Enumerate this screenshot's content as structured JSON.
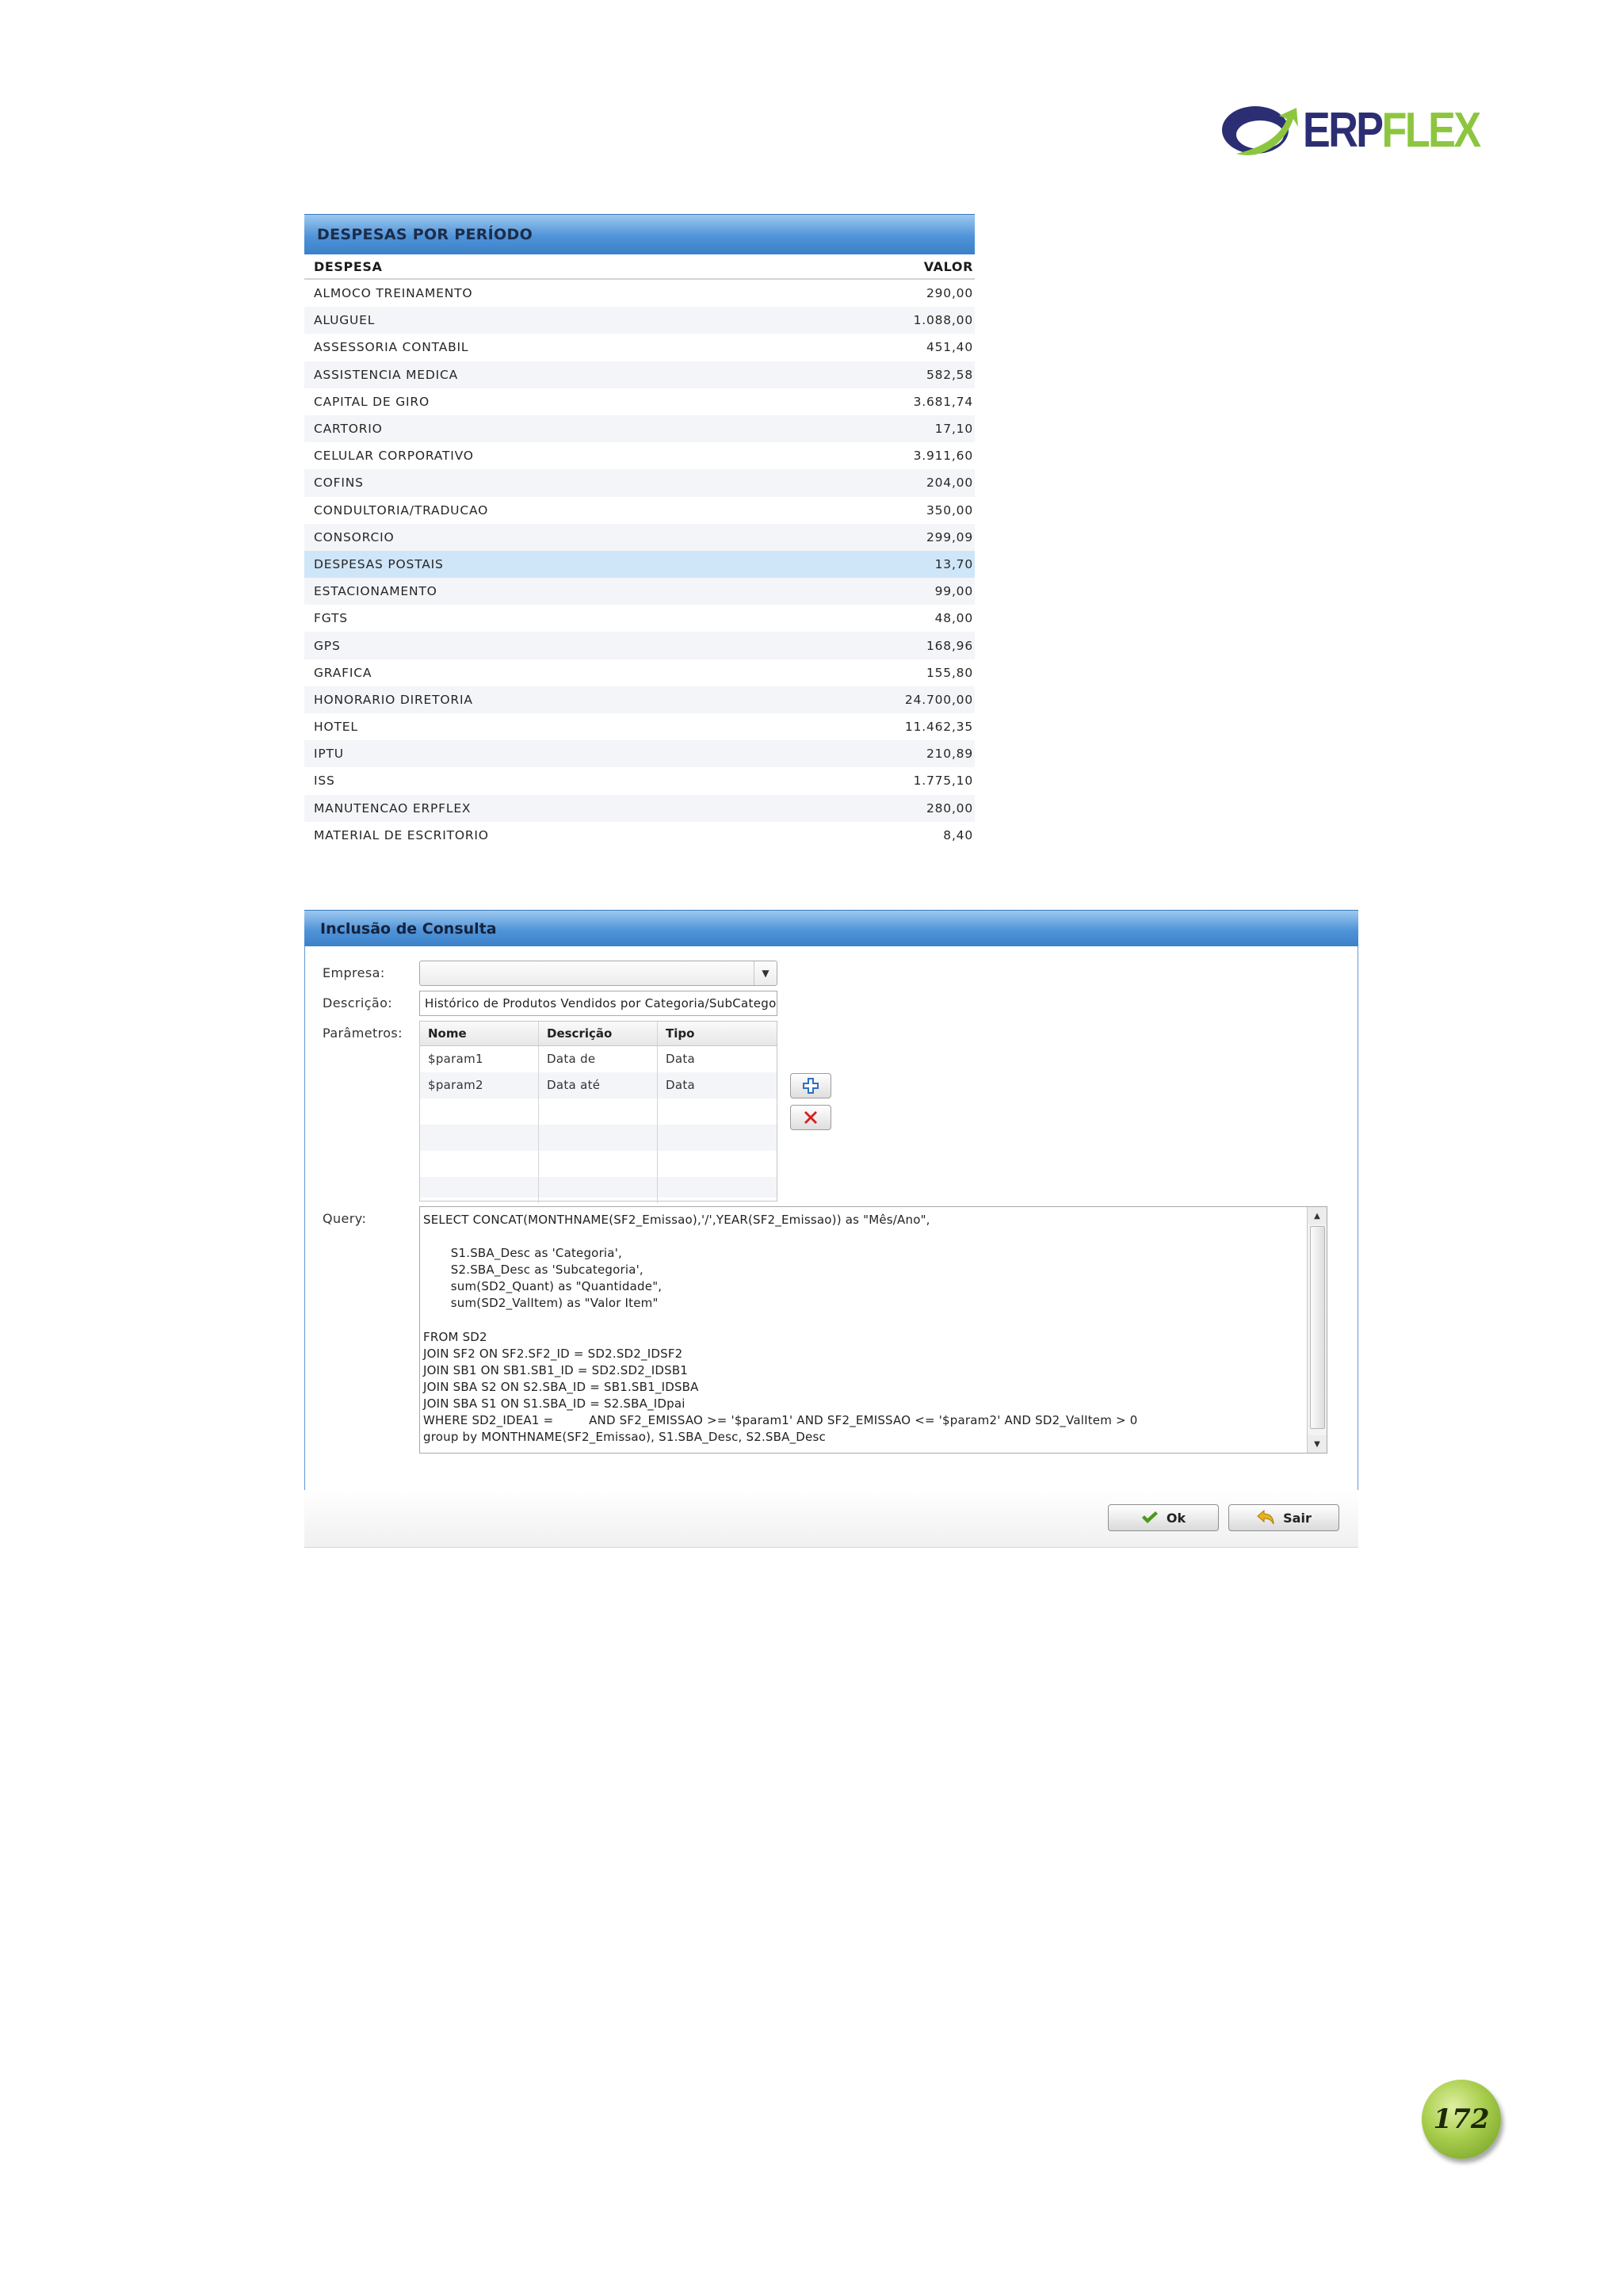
{
  "logo": {
    "part1": "ERP",
    "part2": "FLEX"
  },
  "expenses": {
    "title": "DESPESAS POR PERÍODO",
    "col_despesa": "DESPESA",
    "col_valor": "VALOR",
    "rows": [
      {
        "despesa": "ALMOCO TREINAMENTO",
        "valor": "290,00"
      },
      {
        "despesa": "ALUGUEL",
        "valor": "1.088,00"
      },
      {
        "despesa": "ASSESSORIA CONTABIL",
        "valor": "451,40"
      },
      {
        "despesa": "ASSISTENCIA MEDICA",
        "valor": "582,58"
      },
      {
        "despesa": "CAPITAL DE GIRO",
        "valor": "3.681,74"
      },
      {
        "despesa": "CARTORIO",
        "valor": "17,10"
      },
      {
        "despesa": "CELULAR CORPORATIVO",
        "valor": "3.911,60"
      },
      {
        "despesa": "COFINS",
        "valor": "204,00"
      },
      {
        "despesa": "CONDULTORIA/TRADUCAO",
        "valor": "350,00"
      },
      {
        "despesa": "CONSORCIO",
        "valor": "299,09"
      },
      {
        "despesa": "DESPESAS POSTAIS",
        "valor": "13,70"
      },
      {
        "despesa": "ESTACIONAMENTO",
        "valor": "99,00"
      },
      {
        "despesa": "FGTS",
        "valor": "48,00"
      },
      {
        "despesa": "GPS",
        "valor": "168,96"
      },
      {
        "despesa": "GRAFICA",
        "valor": "155,80"
      },
      {
        "despesa": "HONORARIO DIRETORIA",
        "valor": "24.700,00"
      },
      {
        "despesa": "HOTEL",
        "valor": "11.462,35"
      },
      {
        "despesa": "IPTU",
        "valor": "210,89"
      },
      {
        "despesa": "ISS",
        "valor": "1.775,10"
      },
      {
        "despesa": "MANUTENCAO ERPFLEX",
        "valor": "280,00"
      },
      {
        "despesa": "MATERIAL DE ESCRITORIO",
        "valor": "8,40"
      }
    ]
  },
  "dialog": {
    "title": "Inclusão de Consulta",
    "empresa_label": "Empresa:",
    "empresa_value": "",
    "descricao_label": "Descrição:",
    "descricao_value": "Histórico de Produtos Vendidos por Categoria/SubCategoria",
    "parametros_label": "Parâmetros:",
    "params_columns": [
      "Nome",
      "Descrição",
      "Tipo"
    ],
    "params_rows": [
      {
        "nome": "$param1",
        "descricao": "Data de",
        "tipo": "Data"
      },
      {
        "nome": "$param2",
        "descricao": "Data até",
        "tipo": "Data"
      }
    ],
    "add_icon": "plus-icon",
    "remove_icon": "red-x-icon",
    "query_label": "Query:",
    "query_text": "SELECT CONCAT(MONTHNAME(SF2_Emissao),'/',YEAR(SF2_Emissao)) as \"Mês/Ano\",\n\n       S1.SBA_Desc as 'Categoria',\n       S2.SBA_Desc as 'Subcategoria',\n       sum(SD2_Quant) as \"Quantidade\",\n       sum(SD2_ValItem) as \"Valor Item\"\n\nFROM SD2\nJOIN SF2 ON SF2.SF2_ID = SD2.SD2_IDSF2\nJOIN SB1 ON SB1.SB1_ID = SD2.SD2_IDSB1\nJOIN SBA S2 ON S2.SBA_ID = SB1.SB1_IDSBA\nJOIN SBA S1 ON S1.SBA_ID = S2.SBA_IDpai\nWHERE SD2_IDEA1 =         AND SF2_EMISSAO >= '$param1' AND SF2_EMISSAO <= '$param2' AND SD2_ValItem > 0\ngroup by MONTHNAME(SF2_Emissao), S1.SBA_Desc, S2.SBA_Desc",
    "ok_label": "Ok",
    "sair_label": "Sair"
  },
  "page_number": "172",
  "colors": {
    "header_blue": "#4f93d8",
    "logo_blue": "#2b2e73",
    "logo_green": "#8cc63f",
    "selected_row": "#cfe6f8"
  }
}
